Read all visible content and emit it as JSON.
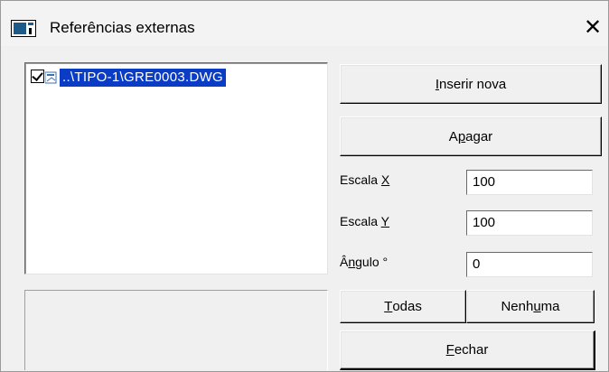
{
  "window": {
    "title": "Referências externas",
    "close_glyph": "✕"
  },
  "xref_list": {
    "items": [
      {
        "label": "..\\TIPO-1\\GRE0003.DWG",
        "checked": true,
        "selected": true
      }
    ]
  },
  "buttons": {
    "insert": {
      "mnemonic": "I",
      "rest": "nserir nova"
    },
    "delete": {
      "pre": "A",
      "mnemonic": "p",
      "rest": "agar"
    },
    "all": {
      "mnemonic": "T",
      "rest": "odas"
    },
    "none": {
      "pre": "Nenh",
      "mnemonic": "u",
      "rest": "ma"
    },
    "close": {
      "mnemonic": "F",
      "rest": "echar"
    }
  },
  "fields": {
    "scale_x": {
      "label_pre": "Escala ",
      "mnemonic": "X",
      "value": "100"
    },
    "scale_y": {
      "label_pre": "Escala ",
      "mnemonic": "Y",
      "value": "100"
    },
    "angle": {
      "label_pre": "Â",
      "mnemonic": "n",
      "label_post": "gulo °",
      "value": "0"
    }
  },
  "colors": {
    "selection": "#0a3cc6",
    "background": "#f0f0f0"
  },
  "icons": {
    "title": "window-app-icon",
    "file": "drawing-file-icon",
    "close": "close-icon"
  }
}
